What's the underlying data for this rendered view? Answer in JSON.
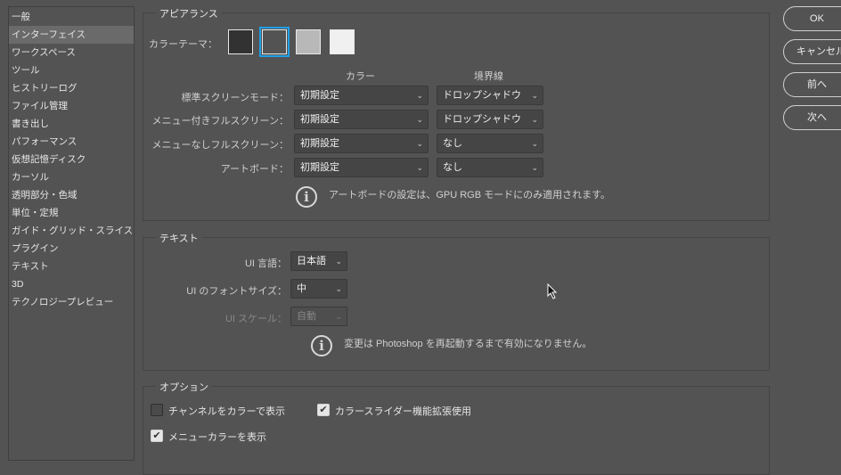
{
  "sidebar": {
    "items": [
      "一般",
      "インターフェイス",
      "ワークスペース",
      "ツール",
      "ヒストリーログ",
      "ファイル管理",
      "書き出し",
      "パフォーマンス",
      "仮想記憶ディスク",
      "カーソル",
      "透明部分・色域",
      "単位・定規",
      "ガイド・グリッド・スライス",
      "プラグイン",
      "テキスト",
      "3D",
      "テクノロジープレビュー"
    ],
    "selected": "インターフェイス"
  },
  "appearance": {
    "title": "アピアランス",
    "color_theme_label": "カラーテーマ：",
    "themes": [
      "#323232",
      "#535353",
      "#b8b8b8",
      "#f0f0f0"
    ],
    "selected_theme": 1,
    "accent": "#1fa0e8",
    "col_color": "カラー",
    "col_border": "境界線",
    "rows": [
      {
        "label": "標準スクリーンモード：",
        "color": "初期設定",
        "border": "ドロップシャドウ"
      },
      {
        "label": "メニュー付きフルスクリーン：",
        "color": "初期設定",
        "border": "ドロップシャドウ"
      },
      {
        "label": "メニューなしフルスクリーン：",
        "color": "初期設定",
        "border": "なし"
      },
      {
        "label": "アートボード：",
        "color": "初期設定",
        "border": "なし"
      }
    ],
    "note": "アートボードの設定は、GPU RGB モードにのみ適用されます。"
  },
  "text": {
    "title": "テキスト",
    "lang_label": "UI 言語：",
    "lang_value": "日本語",
    "font_label": "UI のフォントサイズ：",
    "font_value": "中",
    "scale_label": "UI スケール：",
    "scale_value": "自動",
    "note": "変更は Photoshop を再起動するまで有効になりません。"
  },
  "options": {
    "title": "オプション",
    "channels_color": {
      "label": "チャンネルをカラーで表示",
      "checked": false
    },
    "color_slider": {
      "label": "カラースライダー機能拡張使用",
      "checked": true
    },
    "menu_color": {
      "label": "メニューカラーを表示",
      "checked": true
    }
  },
  "buttons": {
    "ok": "OK",
    "cancel": "キャンセル",
    "prev": "前へ",
    "next": "次へ"
  }
}
